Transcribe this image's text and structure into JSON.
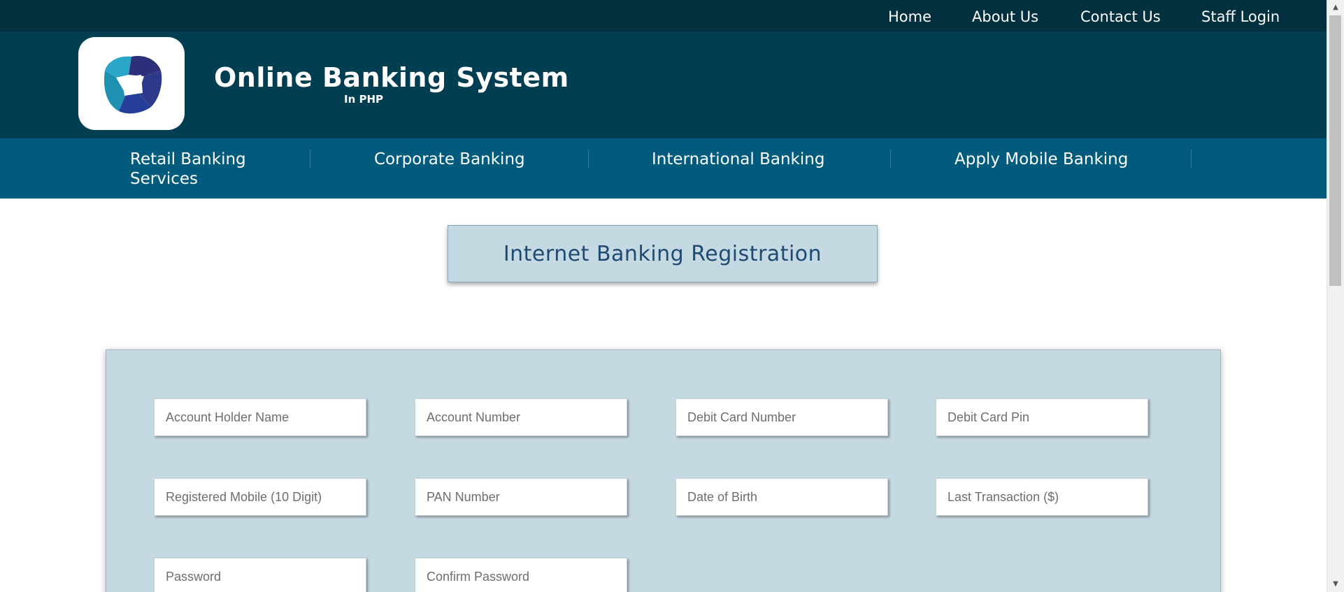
{
  "topnav": {
    "home": "Home",
    "about": "About Us",
    "contact": "Contact Us",
    "staff_login": "Staff Login"
  },
  "header": {
    "title": "Online Banking System",
    "subtitle": "In PHP",
    "logo_colors": [
      "#2aa6c9",
      "#2d3a8c",
      "#1f8fb2"
    ]
  },
  "mainnav": {
    "retail": "Retail Banking Services",
    "corporate": "Corporate Banking",
    "international": "International Banking",
    "mobile": "Apply Mobile Banking"
  },
  "page": {
    "title": "Internet Banking Registration"
  },
  "form": {
    "account_holder_name": "Account Holder Name",
    "account_number": "Account Number",
    "debit_card_number": "Debit Card Number",
    "debit_card_pin": "Debit Card Pin",
    "registered_mobile": "Registered Mobile (10 Digit)",
    "pan_number": "PAN Number",
    "date_of_birth": "Date of Birth",
    "last_transaction": "Last Transaction ($)",
    "password": "Password",
    "confirm_password": "Confirm Password"
  },
  "colors": {
    "topbar": "#02303f",
    "header": "#013e52",
    "nav": "#015b7c",
    "panel": "#c5d9e2",
    "title_text": "#1e4a73"
  }
}
